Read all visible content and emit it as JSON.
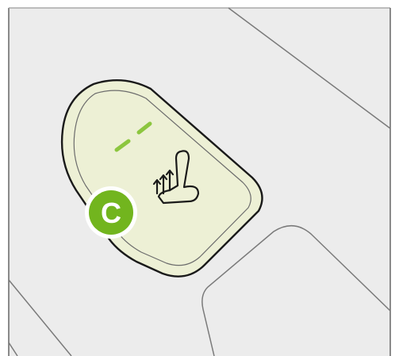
{
  "diagram": {
    "callout": {
      "letter": "C",
      "color": "#72b51e"
    },
    "colors": {
      "panel_fill": "#ececec",
      "panel_line": "#7a7a7a",
      "button_fill": "#edf0d5",
      "button_outline": "#1a1a1a",
      "indicator_leds": "#8cc63f"
    },
    "button": {
      "icon": "heated-seat-icon",
      "indicator_levels_shown": 2
    }
  }
}
